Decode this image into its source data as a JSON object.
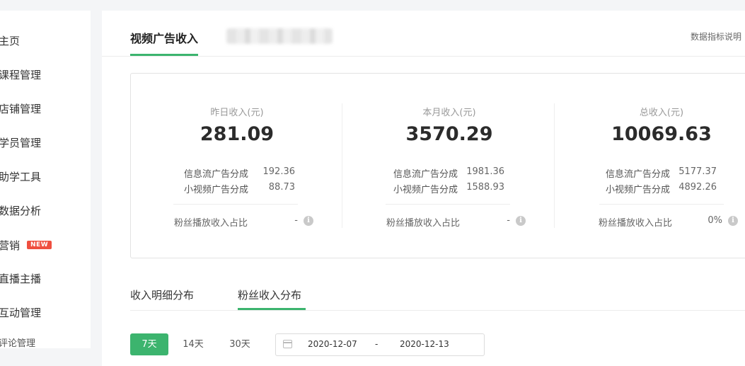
{
  "sidebar": {
    "items": [
      {
        "label": "主页"
      },
      {
        "label": "课程管理"
      },
      {
        "label": "店铺管理"
      },
      {
        "label": "学员管理"
      },
      {
        "label": "助学工具"
      },
      {
        "label": "数据分析"
      },
      {
        "label": "营销",
        "badge": "NEW"
      },
      {
        "label": "直播主播"
      },
      {
        "label": "互动管理"
      },
      {
        "label": "评论管理"
      }
    ]
  },
  "header": {
    "active_tab": "视频广告收入",
    "metrics_link": "数据指标说明"
  },
  "stats": [
    {
      "label": "昨日收入(元)",
      "value": "281.09",
      "rows": [
        {
          "label": "信息流广告分成",
          "value": "192.36"
        },
        {
          "label": "小视频广告分成",
          "value": "88.73"
        }
      ],
      "ratio_label": "粉丝播放收入占比",
      "ratio_value": "-"
    },
    {
      "label": "本月收入(元)",
      "value": "3570.29",
      "rows": [
        {
          "label": "信息流广告分成",
          "value": "1981.36"
        },
        {
          "label": "小视频广告分成",
          "value": "1588.93"
        }
      ],
      "ratio_label": "粉丝播放收入占比",
      "ratio_value": "-"
    },
    {
      "label": "总收入(元)",
      "value": "10069.63",
      "rows": [
        {
          "label": "信息流广告分成",
          "value": "5177.37"
        },
        {
          "label": "小视频广告分成",
          "value": "4892.26"
        }
      ],
      "ratio_label": "粉丝播放收入占比",
      "ratio_value": "0%"
    }
  ],
  "subtabs": [
    {
      "label": "收入明细分布"
    },
    {
      "label": "粉丝收入分布",
      "active": true
    }
  ],
  "filters": {
    "days": [
      "7天",
      "14天",
      "30天"
    ],
    "active_day": "7天",
    "date_start": "2020-12-07",
    "date_separator": "-",
    "date_end": "2020-12-13"
  },
  "colors": {
    "accent": "#3cb46e",
    "badge": "#ef4f3f"
  }
}
